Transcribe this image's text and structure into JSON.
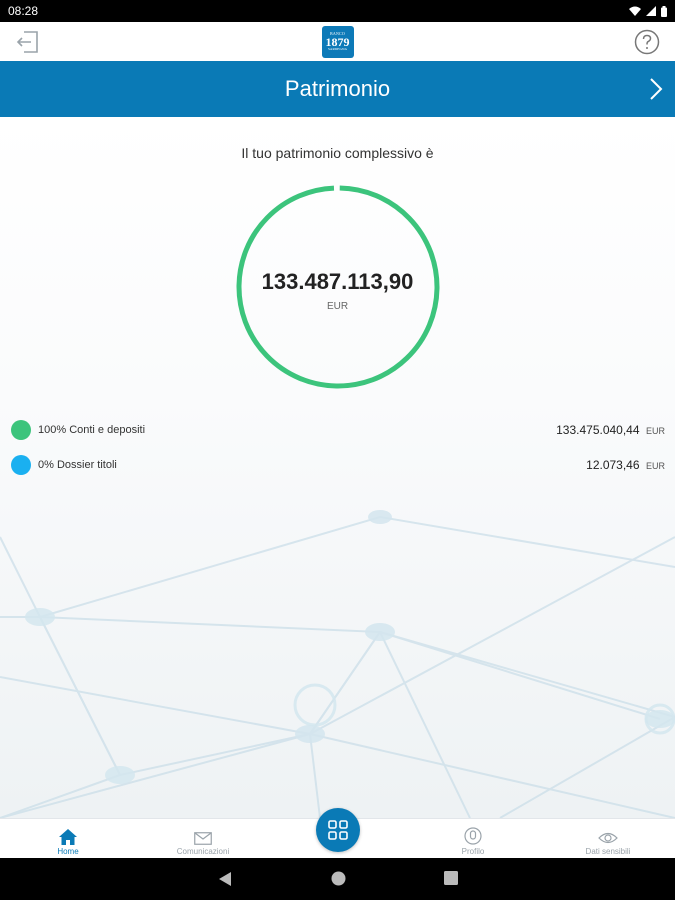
{
  "status": {
    "time": "08:28"
  },
  "header": {
    "logo_top": "BANCO",
    "logo_year": "1879",
    "logo_bottom": "SARDEGNA"
  },
  "title_bar": {
    "title": "Patrimonio"
  },
  "summary": {
    "intro": "Il tuo patrimonio complessivo è",
    "total": "133.487.113,90",
    "currency": "EUR"
  },
  "breakdown": [
    {
      "label": "100% Conti e depositi",
      "amount": "133.475.040,44",
      "currency": "EUR",
      "color": "#3cc47c"
    },
    {
      "label": "0% Dossier titoli",
      "amount": "12.073,46",
      "currency": "EUR",
      "color": "#1ab0f0"
    }
  ],
  "bottom_nav": [
    {
      "label": "Home",
      "icon": "home-icon",
      "active": true
    },
    {
      "label": "Comunicazioni",
      "icon": "mail-icon",
      "active": false
    },
    {
      "label": "Profilo",
      "icon": "profile-icon",
      "active": false
    },
    {
      "label": "Dati sensibili",
      "icon": "eye-icon",
      "active": false
    }
  ],
  "fab": {
    "icon": "grid-icon"
  },
  "colors": {
    "brand": "#0a7ab6",
    "green": "#3cc47c",
    "blue": "#1ab0f0"
  }
}
